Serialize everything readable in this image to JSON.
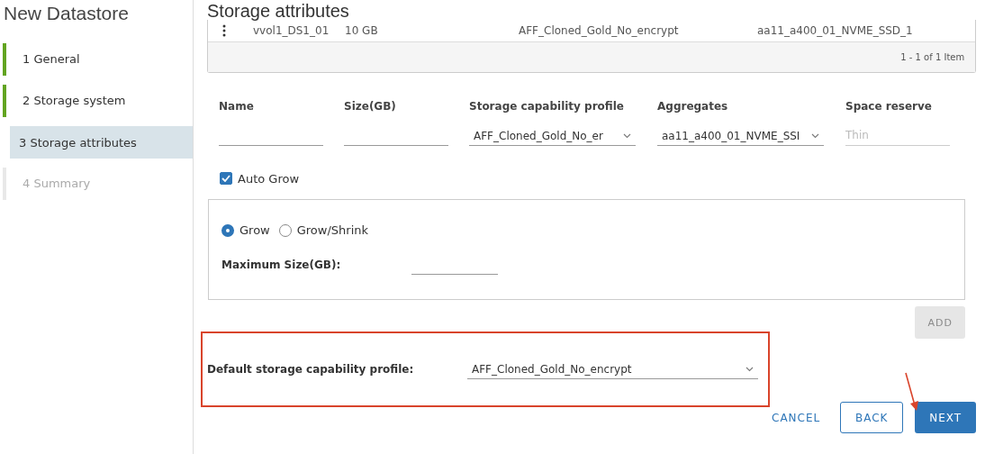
{
  "wizard": {
    "title": "New Datastore",
    "steps": [
      {
        "label": "1 General",
        "selected": false,
        "completed": true,
        "disabled": false
      },
      {
        "label": "2 Storage system",
        "selected": false,
        "completed": true,
        "disabled": false
      },
      {
        "label": "3 Storage attributes",
        "selected": true,
        "completed": false,
        "disabled": false
      },
      {
        "label": "4 Summary",
        "selected": false,
        "completed": false,
        "disabled": true
      }
    ]
  },
  "page_title": "Storage attributes",
  "table": {
    "rows": [
      {
        "cells": [
          "vvol1_DS1_01",
          "10 GB",
          "AFF_Cloned_Gold_No_encrypt",
          "aa11_a400_01_NVME_SSD_1"
        ]
      }
    ],
    "footer": "1 - 1 of 1 Item"
  },
  "form": {
    "fields": [
      {
        "label": "Name",
        "kind": "text",
        "disabled": false
      },
      {
        "label": "Size(GB)",
        "kind": "text",
        "disabled": false
      },
      {
        "label": "Storage capability profile",
        "kind": "select",
        "value": "AFF_Cloned_Gold_No_er",
        "disabled": false
      },
      {
        "label": "Aggregates",
        "kind": "select",
        "value": "aa11_a400_01_NVME_SSI",
        "disabled": false
      },
      {
        "label": "Space reserve",
        "kind": "text",
        "value": "Thin",
        "disabled": true
      }
    ]
  },
  "auto_grow": {
    "label": "Auto Grow",
    "checked": true
  },
  "grow_options": [
    {
      "label": "Grow",
      "selected": true
    },
    {
      "label": "Grow/Shrink",
      "selected": false
    }
  ],
  "max_size": {
    "label": "Maximum Size(GB):"
  },
  "add_button": {
    "label": "ADD",
    "disabled": true
  },
  "default_profile": {
    "label": "Default storage capability profile:",
    "value": "AFF_Cloned_Gold_No_encrypt"
  },
  "buttons": [
    {
      "label": "CANCEL",
      "kind": "link"
    },
    {
      "label": "BACK",
      "kind": "outline"
    },
    {
      "label": "NEXT",
      "kind": "primary"
    }
  ]
}
